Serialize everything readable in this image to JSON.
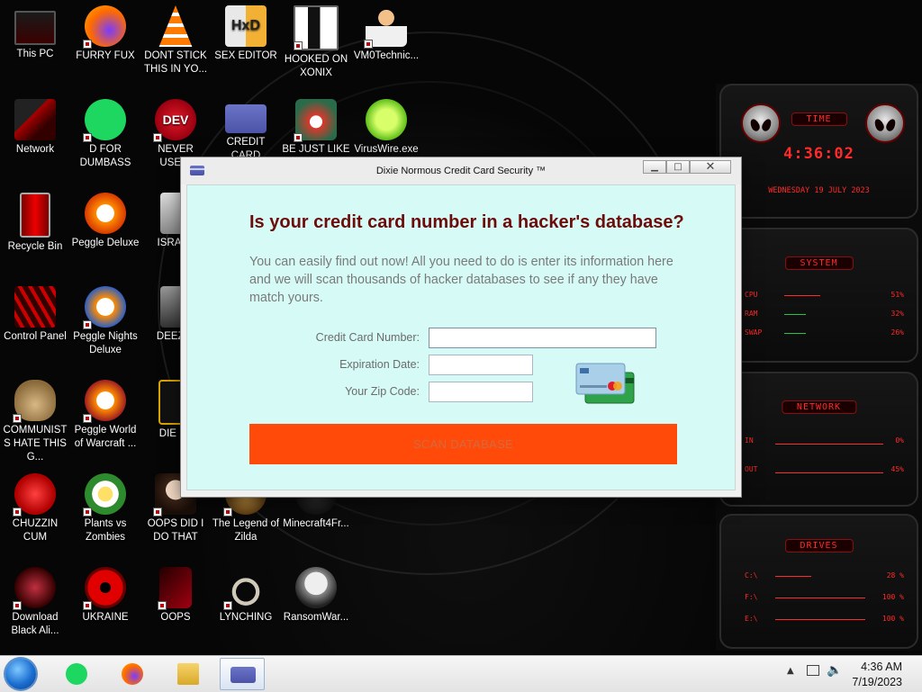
{
  "desktop": {
    "icons": [
      {
        "label": "This PC"
      },
      {
        "label": "FURRY FUX"
      },
      {
        "label": "DONT STICK THIS IN YO..."
      },
      {
        "label": "SEX EDITOR"
      },
      {
        "label": "HOOKED ON XONIX"
      },
      {
        "label": "VM0Technic..."
      },
      {
        "label": "Network"
      },
      {
        "label": "D FOR DUMBASS"
      },
      {
        "label": "NEVER USED!"
      },
      {
        "label": "CREDIT CARD"
      },
      {
        "label": "BE JUST LIKE"
      },
      {
        "label": "VirusWire.exe"
      },
      {
        "label": "Recycle Bin"
      },
      {
        "label": "Peggle Deluxe"
      },
      {
        "label": "ISRAEL"
      },
      {
        "label": "Control Panel"
      },
      {
        "label": "Peggle Nights Deluxe"
      },
      {
        "label": "DEEZ N"
      },
      {
        "label": "COMMUNISTS HATE THIS G..."
      },
      {
        "label": "Peggle World of Warcraft ..."
      },
      {
        "label": "DIE PL"
      },
      {
        "label": "CHUZZIN CUM"
      },
      {
        "label": "Plants vs Zombies"
      },
      {
        "label": "OOPS DID I DO THAT"
      },
      {
        "label": "The Legend of Zilda"
      },
      {
        "label": "Minecraft4Fr..."
      },
      {
        "label": "Download Black Ali..."
      },
      {
        "label": "UKRAINE"
      },
      {
        "label": "OOPS"
      },
      {
        "label": "LYNCHING"
      },
      {
        "label": "RansomWar..."
      }
    ]
  },
  "window": {
    "title": "Dixie Normous Credit Card Security ™",
    "controls": {
      "minimize": "▁",
      "maximize": "□",
      "close": "✕"
    },
    "headline": "Is your credit card number in a hacker's database?",
    "intro": "You can easily find out now! All you need to do is enter its information here and we will scan thousands of hacker databases to see if any they have match yours.",
    "form": {
      "cc_label": "Credit Card Number:",
      "cc_value": "",
      "exp_label": "Expiration Date:",
      "exp_value": "",
      "zip_label": "Your Zip Code:",
      "zip_value": ""
    },
    "scan_button": "SCAN DATABASE"
  },
  "widget": {
    "time_title": "TIME",
    "time": "4:36:02",
    "date": "WEDNESDAY 19 JULY 2023",
    "system_title": "SYSTEM",
    "system_rows": [
      {
        "name": "CPU",
        "value": "51%"
      },
      {
        "name": "RAM",
        "value": "32%"
      },
      {
        "name": "SWAP",
        "value": "26%"
      }
    ],
    "network_title": "NETWORK",
    "network_rows": [
      {
        "name": "IN",
        "value": "0%"
      },
      {
        "name": "OUT",
        "value": "45%"
      }
    ],
    "drives_title": "DRIVES",
    "drives_rows": [
      {
        "name": "C:\\",
        "value": "28 %"
      },
      {
        "name": "F:\\",
        "value": "100 %"
      },
      {
        "name": "E:\\",
        "value": "100 %"
      }
    ]
  },
  "taskbar": {
    "clock_time": "4:36 AM",
    "clock_date": "7/19/2023"
  },
  "colors": {
    "accent_red": "#ff2a2a",
    "headline": "#6e0b0b",
    "scan_button": "#ff4a0a",
    "window_client": "#d6fbf6"
  }
}
